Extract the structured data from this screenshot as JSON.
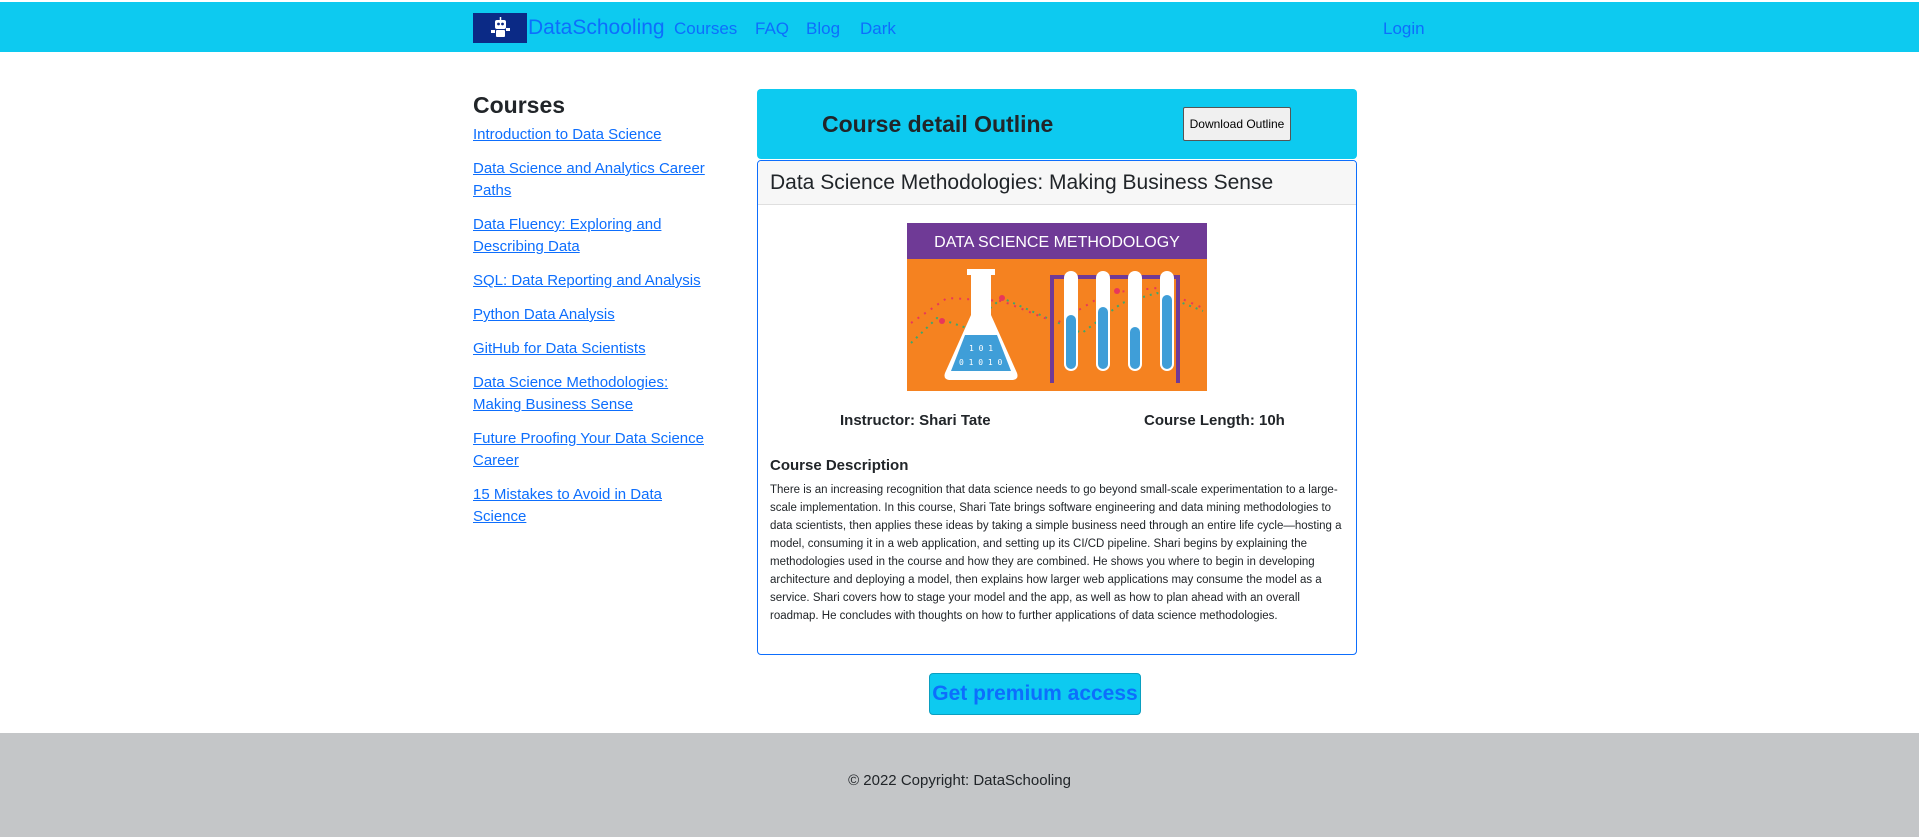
{
  "navbar": {
    "brand": "DataSchooling",
    "links": [
      "Courses",
      "FAQ",
      "Blog",
      "Dark"
    ],
    "login": "Login",
    "icon": "robot-logo-icon"
  },
  "sidebar": {
    "title": "Courses",
    "items": [
      "Introduction to Data Science",
      "Data Science and Analytics Career Paths",
      "Data Fluency: Exploring and Describing Data",
      "SQL: Data Reporting and Analysis",
      "Python Data Analysis",
      "GitHub for Data Scientists",
      "Data Science Methodologies: Making Business Sense",
      "Future Proofing Your Data Science Career",
      "15 Mistakes to Avoid in Data Science"
    ]
  },
  "outline": {
    "title": "Course detail Outline",
    "download_label": "Download Outline"
  },
  "course": {
    "title": "Data Science Methodologies: Making Business Sense",
    "image_banner": "DATA SCIENCE METHODOLOGY",
    "instructor": "Instructor: Shari Tate",
    "length": "Course Length: 10h",
    "description_title": "Course Description",
    "description": "There is an increasing recognition that data science needs to go beyond small-scale experimentation to a large-scale implementation. In this course, Shari Tate brings software engineering and data mining methodologies to data scientists, then applies these ideas by taking a simple business need through an entire life cycle—hosting a model, consuming it in a web application, and setting up its CI/CD pipeline. Shari begins by explaining the methodologies used in the course and how they are combined. He shows you where to begin in developing architecture and deploying a model, then explains how larger web applications may consume the model as a service. Shari covers how to stage your model and the app, as well as how to plan ahead with an overall roadmap. He concludes with thoughts on how to further applications of data science methodologies."
  },
  "premium_label": "Get premium access",
  "footer": "© 2022 Copyright: DataSchooling",
  "colors": {
    "accent": "#0dcaf0",
    "link": "#0d6efd",
    "footer_bg": "#c4c6c8",
    "banner_purple": "#6f3a96",
    "banner_orange": "#f58220"
  }
}
